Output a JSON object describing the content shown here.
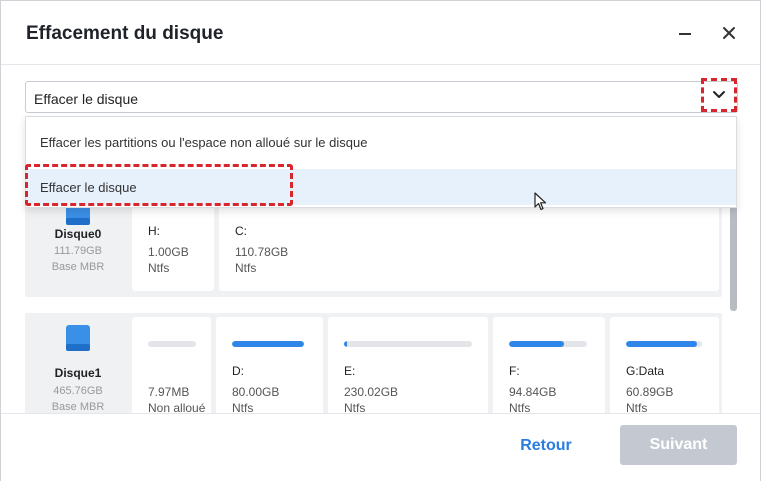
{
  "window": {
    "title": "Effacement du disque"
  },
  "mode_select": {
    "value": "Effacer le disque",
    "options": [
      "Effacer les partitions ou l'espace non alloué sur le disque",
      "Effacer le disque"
    ],
    "selected_index": 1
  },
  "disks": [
    {
      "name": "Disque0",
      "size": "111.79GB",
      "type": "Base MBR",
      "partitions": [
        {
          "letter": "H:",
          "size": "1.00GB",
          "fs": "Ntfs"
        },
        {
          "letter": "C:",
          "size": "110.78GB",
          "fs": "Ntfs"
        }
      ]
    },
    {
      "name": "Disque1",
      "size": "465.76GB",
      "type": "Base MBR",
      "partitions": [
        {
          "letter": "",
          "size": "7.97MB",
          "fs": "Non alloué",
          "fill": 0
        },
        {
          "letter": "D:",
          "size": "80.00GB",
          "fs": "Ntfs",
          "fill": 1.0
        },
        {
          "letter": "E:",
          "size": "230.02GB",
          "fs": "Ntfs",
          "fill": 0.02
        },
        {
          "letter": "F:",
          "size": "94.84GB",
          "fs": "Ntfs",
          "fill": 0.7
        },
        {
          "letter": "G:Data",
          "size": "60.89GB",
          "fs": "Ntfs",
          "fill": 0.93
        }
      ]
    }
  ],
  "footer": {
    "back_label": "Retour",
    "next_label": "Suivant"
  },
  "colors": {
    "accent": "#2f86e8",
    "highlight_dash": "#d7262c",
    "disabled_button": "#c4c9d1"
  },
  "icons": {
    "minimize": "minimize-icon",
    "close": "close-icon",
    "dropdown": "chevron-down-icon",
    "disk": "hard-disk-icon"
  }
}
